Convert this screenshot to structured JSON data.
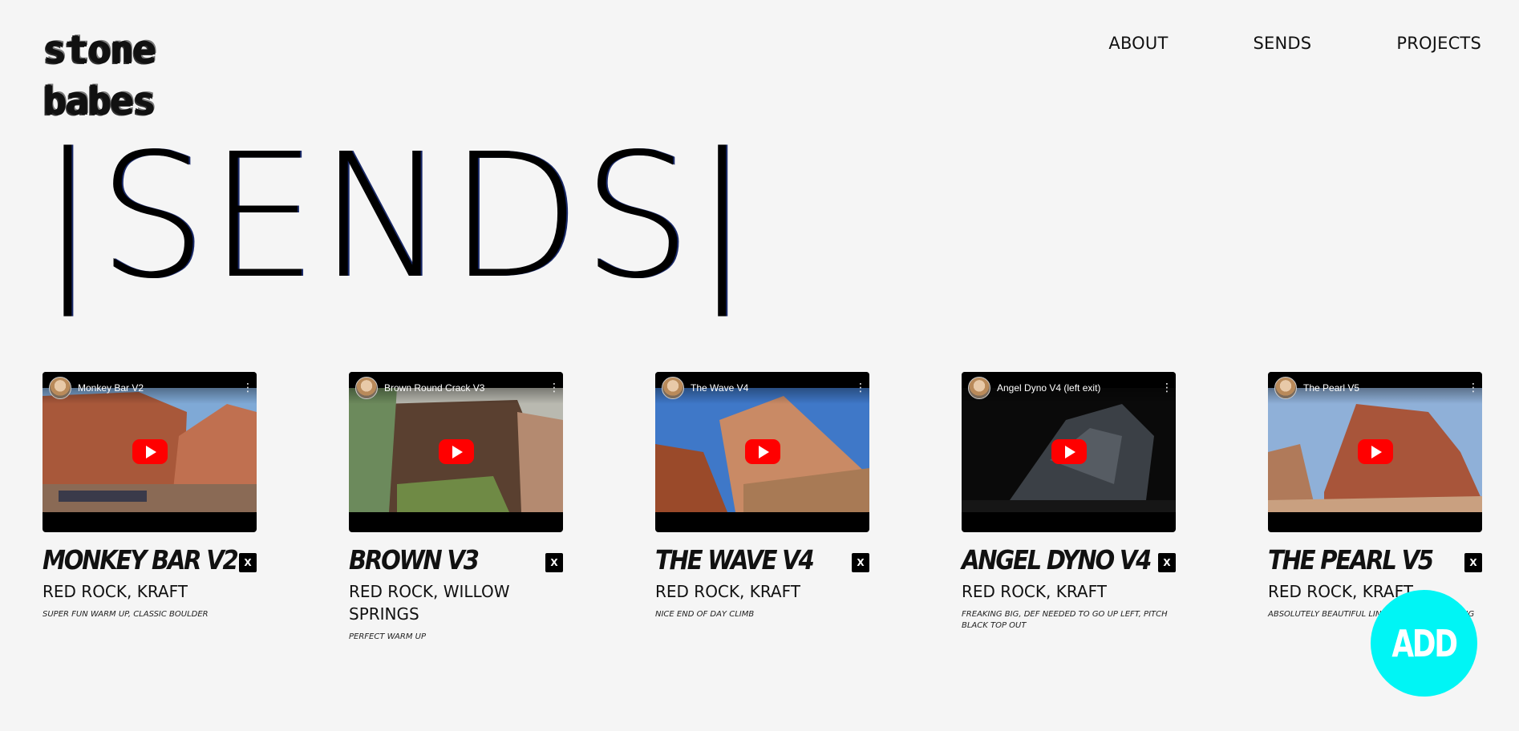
{
  "logo": {
    "line1": "stone",
    "line2": "babes"
  },
  "nav": [
    {
      "label": "ABOUT"
    },
    {
      "label": "SENDS"
    },
    {
      "label": "PROJECTS"
    }
  ],
  "page_title": "|SENDS|",
  "sends": [
    {
      "video_title": "Monkey Bar V2",
      "name": "MONKEY BAR V2",
      "location": "RED ROCK, KRAFT",
      "note": "SUPER FUN WARM UP, CLASSIC BOULDER",
      "close_label": "X"
    },
    {
      "video_title": "Brown Round Crack V3",
      "name": "BROWN V3",
      "location": "RED ROCK, WILLOW SPRINGS",
      "note": "PERFECT WARM UP",
      "close_label": "X"
    },
    {
      "video_title": "The Wave V4",
      "name": "THE WAVE V4",
      "location": "RED ROCK, KRAFT",
      "note": "NICE END OF DAY CLIMB",
      "close_label": "X"
    },
    {
      "video_title": "Angel Dyno V4 (left exit)",
      "name": "ANGEL DYNO V4",
      "location": "RED ROCK, KRAFT",
      "note": "FREAKING BIG, DEF NEEDED TO GO UP LEFT, PITCH BLACK TOP OUT",
      "close_label": "X"
    },
    {
      "video_title": "The Pearl V5",
      "name": "THE PEARL V5",
      "location": "RED ROCK, KRAFT",
      "note": "ABSOLUTELY BEAUTIFUL LINE, THE MOVES ARE BIG",
      "close_label": "X"
    }
  ],
  "add_button": "ADD",
  "colors": {
    "background": "#f5f5f5",
    "accent": "#00f5f5",
    "play": "#ff0000"
  }
}
